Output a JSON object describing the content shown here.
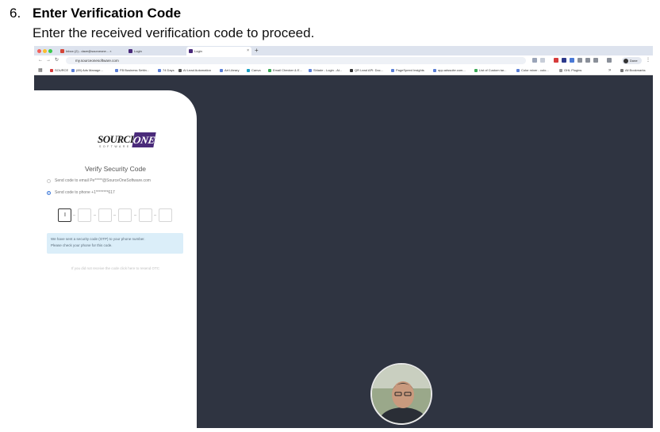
{
  "step": {
    "number": "6.",
    "title": "Enter Verification Code",
    "description": "Enter the received verification code to proceed."
  },
  "browser": {
    "tabs": [
      {
        "label": "Inbox (2) - dave@sourceone... ×",
        "active": false
      },
      {
        "label": "Login",
        "active": false
      },
      {
        "label": "Login",
        "active": true
      }
    ],
    "url": "my.sourceonesoftware.com",
    "profile_label": "Done",
    "bookmarks": [
      "SOURCE",
      "(69) Ads Manage...",
      "FB Business Settin...",
      "74 Days",
      "AI Lead Automation",
      "Art Library",
      "Canva",
      "Email Checker & E...",
      "Shlade - Login - At...",
      "QR Lead API: Doc...",
      "PageSpeed Insights",
      "app.adssuite.com...",
      "List of Custom tar...",
      "Color mixer - colo...",
      "GHL Plugins",
      "All Bookmarks"
    ]
  },
  "login": {
    "logo_source": "SOURCE",
    "logo_one": "ONE",
    "logo_sub": "SOFTWARE",
    "title": "Verify Security Code",
    "option_email": "Send code to email  Pe*****@SourceOneSoftware.com",
    "option_phone": "Send code to phone  +1********617",
    "cursor_glyph": "I",
    "info_line_1": "We have sent a security code (OTP) to your phone number.",
    "info_line_2": "Please check your phone for this code.",
    "resend": "If you did not receive the code click here to resend OTC"
  },
  "colors": {
    "page_background": "#2f3441",
    "logo_accent": "#4a2a7a",
    "info_background": "#dbeef9",
    "radio_selected": "#3d78d8"
  }
}
